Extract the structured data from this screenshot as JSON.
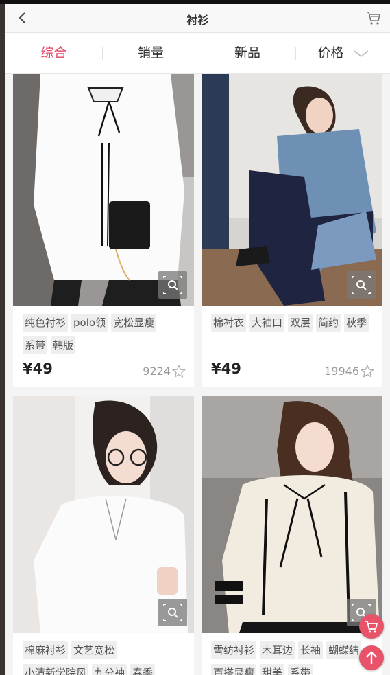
{
  "nav": {
    "title": "衬衫",
    "back_icon": "chevron-left-icon",
    "cart_icon": "cart-icon"
  },
  "tabs": [
    {
      "label": "综合",
      "active": true
    },
    {
      "label": "销量",
      "active": false
    },
    {
      "label": "新品",
      "active": false
    },
    {
      "label": "价格",
      "active": false,
      "icon": "chevron-down-icon"
    }
  ],
  "products": [
    {
      "tags": [
        "纯色衬衫",
        "polo领",
        "宽松显瘦",
        "系带",
        "韩版"
      ],
      "price": "¥49",
      "sales": "9224"
    },
    {
      "tags": [
        "棉衬衣",
        "大袖口",
        "双层",
        "简约",
        "秋季"
      ],
      "price": "¥49",
      "sales": "19946"
    },
    {
      "tags": [
        "棉麻衬衫",
        "文艺宽松",
        "小清新学院风",
        "九分袖",
        "春季"
      ],
      "price": "",
      "sales": ""
    },
    {
      "tags": [
        "雪纺衬衫",
        "木耳边",
        "长袖",
        "蝴蝶结",
        "百搭显瘦",
        "甜美",
        "系带"
      ],
      "price": "",
      "sales": ""
    }
  ],
  "floating": {
    "cart_icon": "cart-icon",
    "top_icon": "arrow-up-icon"
  },
  "colors": {
    "accent": "#e64764",
    "floating_button": "#e8536a"
  }
}
